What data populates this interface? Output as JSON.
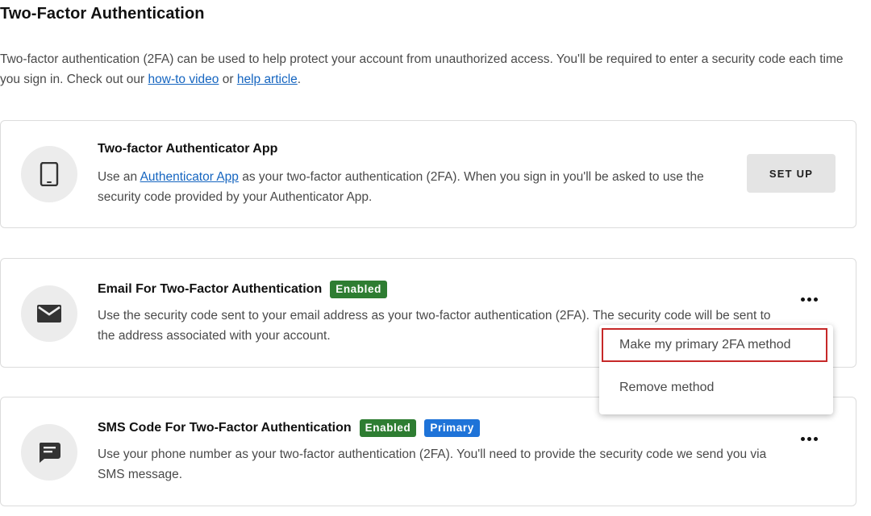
{
  "page": {
    "title": "Two-Factor Authentication",
    "intro": {
      "text_before": "Two-factor authentication (2FA) can be used to help protect your account from unauthorized access. You'll be required to enter a security code each time you sign in. Check out our ",
      "link1": "how-to video",
      "text_between": " or ",
      "link2": "help article",
      "text_after": "."
    }
  },
  "methods": [
    {
      "title": "Two-factor Authenticator App",
      "icon": "tablet-icon",
      "desc_before": "Use an ",
      "desc_link": "Authenticator App",
      "desc_after": " as your two-factor authentication (2FA). When you sign in you'll be asked to use the security code provided by your Authenticator App.",
      "action_label": "SET UP"
    },
    {
      "title": "Email For Two-Factor Authentication",
      "icon": "envelope-icon",
      "badge_enabled": "Enabled",
      "desc": "Use the security code sent to your email address as your two-factor authentication (2FA). The security code will be sent to the address associated with your account.",
      "menu": {
        "items": [
          "Make my primary 2FA method",
          "Remove method"
        ]
      }
    },
    {
      "title": "SMS Code For Two-Factor Authentication",
      "icon": "chat-message-icon",
      "badge_enabled": "Enabled",
      "badge_primary": "Primary",
      "desc": "Use your phone number as your two-factor authentication (2FA). You'll need to provide the security code we send you via SMS message."
    }
  ],
  "colors": {
    "link": "#1565c0",
    "enabled_badge": "#2e7d32",
    "primary_badge": "#1e73d8",
    "highlight_border": "#c62828"
  }
}
